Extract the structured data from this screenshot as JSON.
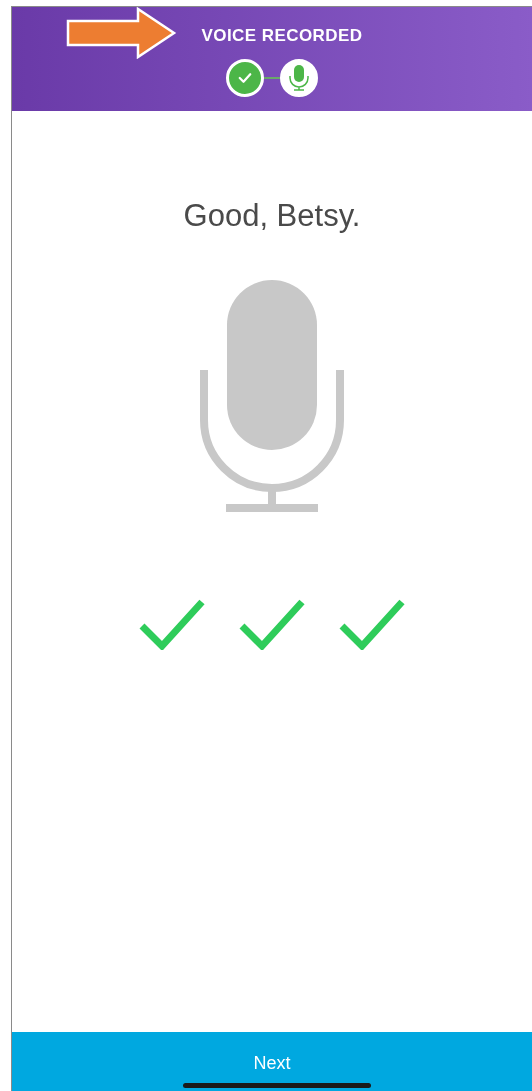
{
  "header": {
    "title": "VOICE RECORDED",
    "steps": [
      {
        "kind": "check",
        "completed": true
      },
      {
        "kind": "mic",
        "completed": false
      }
    ]
  },
  "greeting": "Good, Betsy.",
  "attempts": [
    {
      "passed": true
    },
    {
      "passed": true
    },
    {
      "passed": true
    }
  ],
  "next_button": "Next"
}
